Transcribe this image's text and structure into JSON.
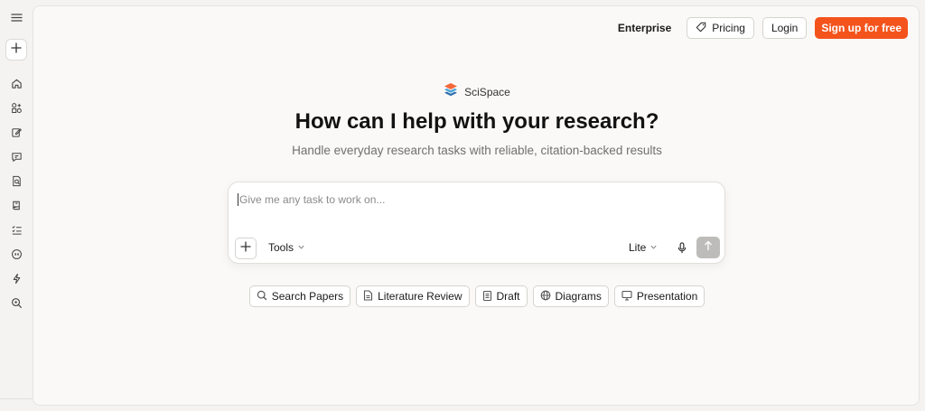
{
  "sidebar": {
    "menu_icon": "menu-icon",
    "new_icon": "plus-icon",
    "items": [
      {
        "name": "home",
        "icon": "home-icon"
      },
      {
        "name": "apps",
        "icon": "apps-icon"
      },
      {
        "name": "write",
        "icon": "edit-icon"
      },
      {
        "name": "chat",
        "icon": "chat-icon"
      },
      {
        "name": "document-search",
        "icon": "doc-search-icon"
      },
      {
        "name": "library",
        "icon": "library-icon"
      },
      {
        "name": "list",
        "icon": "list-icon"
      },
      {
        "name": "citation",
        "icon": "citation-icon"
      },
      {
        "name": "flash",
        "icon": "lightning-icon"
      },
      {
        "name": "zoom-search",
        "icon": "search-zoom-icon"
      }
    ]
  },
  "nav": {
    "enterprise": "Enterprise",
    "pricing": "Pricing",
    "login": "Login",
    "signup": "Sign up for free"
  },
  "brand": {
    "name": "SciSpace"
  },
  "hero": {
    "title": "How can I help with your research?",
    "subtitle": "Handle everyday research tasks with reliable, citation-backed results"
  },
  "composer": {
    "placeholder": "Give me any task to work on...",
    "tools_label": "Tools",
    "mode_label": "Lite"
  },
  "chips": [
    {
      "label": "Search Papers",
      "icon": "search-icon"
    },
    {
      "label": "Literature Review",
      "icon": "document-icon"
    },
    {
      "label": "Draft",
      "icon": "clipboard-icon"
    },
    {
      "label": "Diagrams",
      "icon": "globe-icon"
    },
    {
      "label": "Presentation",
      "icon": "monitor-icon"
    }
  ],
  "colors": {
    "accent": "#f4531c",
    "background": "#f4f3f1",
    "panel": "#faf9f7"
  }
}
